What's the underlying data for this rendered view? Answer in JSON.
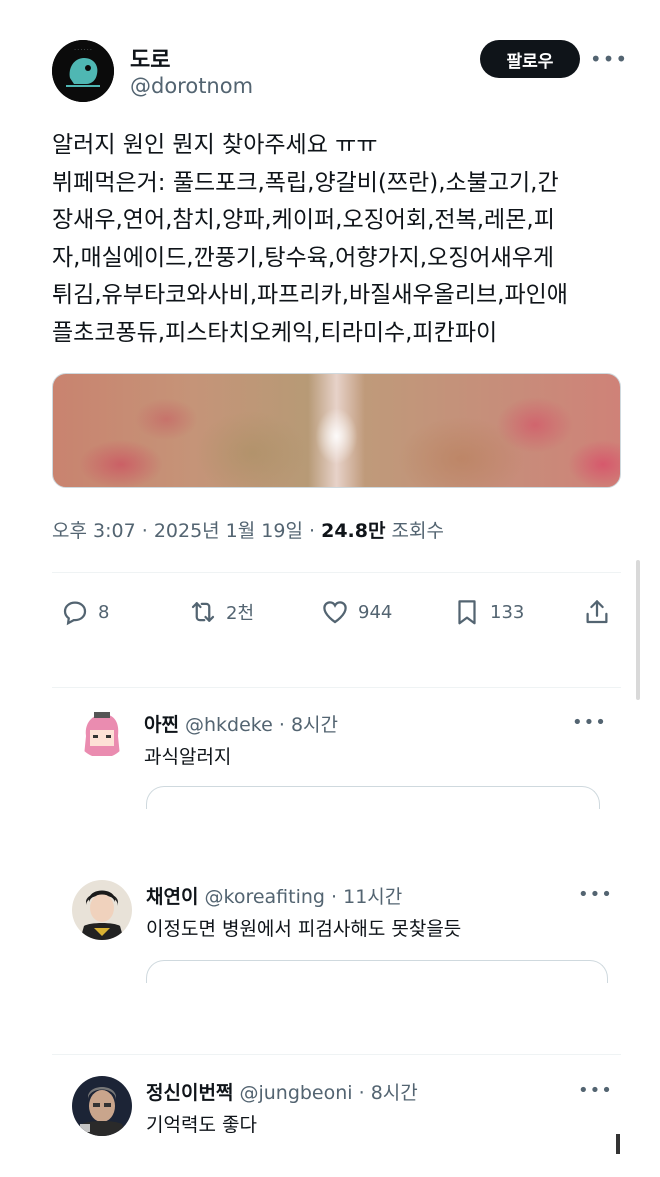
{
  "author": {
    "display_name": "도로",
    "handle": "@dorotnom",
    "follow_label": "팔로우"
  },
  "tweet": {
    "lines": [
      "알러지 원인 뭔지 찾아주세요 ㅠㅠ",
      "뷔페먹은거: 풀드포크,폭립,양갈비(쯔란),소불고기,간",
      "장새우,연어,참치,양파,케이퍼,오징어회,전복,레몬,피",
      "자,매실에이드,깐풍기,탕수육,어향가지,오징어새우게",
      "튀김,유부타코와사비,파프리카,바질새우올리브,파인애",
      "플초코퐁듀,피스타치오케익,티라미수,피칸파이"
    ],
    "time": "오후 3:07",
    "date": "2025년 1월 19일",
    "views_count": "24.8만",
    "views_label": "조회수"
  },
  "actions": {
    "replies": "8",
    "retweets": "2천",
    "likes": "944",
    "bookmarks": "133"
  },
  "replies": [
    {
      "name": "아찐",
      "handle": "@hkdeke",
      "time": "8시간",
      "text": "과식알러지"
    },
    {
      "name": "채연이",
      "handle": "@koreafiting",
      "time": "11시간",
      "text": "이정도면 병원에서 피검사해도 못찾을듯"
    },
    {
      "name": "정신이번쩍",
      "handle": "@jungbeoni",
      "time": "8시간",
      "text": "기억력도 좋다"
    }
  ],
  "icons": {
    "reply": "reply-icon",
    "retweet": "retweet-icon",
    "like": "heart-icon",
    "bookmark": "bookmark-icon",
    "share": "share-icon",
    "more": "more-icon"
  },
  "colors": {
    "text": "#0f1419",
    "secondary": "#536471",
    "follow_bg": "#0f1419",
    "border": "#eff3f4"
  }
}
